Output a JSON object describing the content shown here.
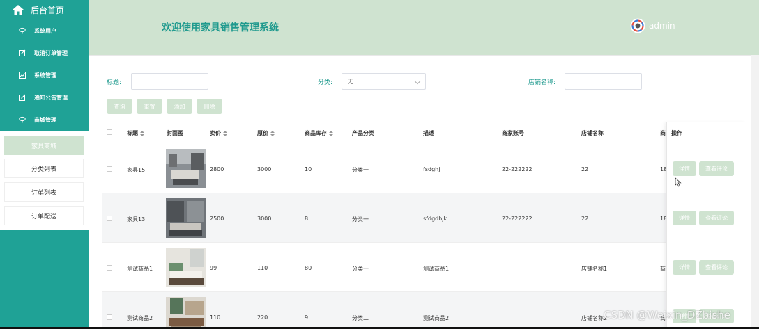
{
  "sidebar": {
    "home_label": "后台首页",
    "items": [
      {
        "label": "系统用户",
        "icon": "shield-icon"
      },
      {
        "label": "取消订单管理",
        "icon": "edit-icon"
      },
      {
        "label": "系统管理",
        "icon": "chart-icon"
      },
      {
        "label": "通知公告管理",
        "icon": "edit-icon"
      },
      {
        "label": "商城管理",
        "icon": "shield-icon"
      }
    ],
    "sub_items": [
      {
        "label": "家具商城",
        "active": true
      },
      {
        "label": "分类列表",
        "active": false
      },
      {
        "label": "订单列表",
        "active": false
      },
      {
        "label": "订单配送",
        "active": false
      }
    ]
  },
  "header": {
    "title": "欢迎使用家具销售管理系统",
    "username": "admin"
  },
  "search": {
    "title_label": "标题:",
    "title_value": "",
    "category_label": "分类:",
    "category_value": "无",
    "shop_label": "店铺名称:",
    "shop_value": ""
  },
  "actions": {
    "query": "查询",
    "reset": "重置",
    "add": "添加",
    "delete": "删除"
  },
  "table": {
    "columns": [
      "标题",
      "封面图",
      "卖价",
      "原价",
      "商品库存",
      "产品分类",
      "描述",
      "商家账号",
      "店铺名称",
      "商",
      "操作"
    ],
    "rows": [
      {
        "title": "家具15",
        "price": "2800",
        "original": "3000",
        "stock": "10",
        "category": "分类一",
        "desc": "fsdghj",
        "merchant": "22-222222",
        "shop": "22",
        "extra": "18"
      },
      {
        "title": "家具13",
        "price": "2500",
        "original": "3000",
        "stock": "8",
        "category": "分类一",
        "desc": "sfdgdhjk",
        "merchant": "22-222222",
        "shop": "22",
        "extra": "18"
      },
      {
        "title": "测试商品1",
        "price": "99",
        "original": "110",
        "stock": "80",
        "category": "分类一",
        "desc": "测试商品1",
        "merchant": "",
        "shop": "店铺名称1",
        "extra": "商"
      },
      {
        "title": "测试商品2",
        "price": "110",
        "original": "220",
        "stock": "9",
        "category": "分类二",
        "desc": "测试商品2",
        "merchant": "",
        "shop": "店铺名称2",
        "extra": "商"
      }
    ],
    "detail_label": "详情",
    "review_label": "查看评论"
  },
  "watermark": "CSDN @Weixin_DZbishe",
  "colors": {
    "sidebar": "#1fa296",
    "header": "#cfe3d0",
    "accent_text": "#1f9a8e",
    "button": "#cfe3d0"
  }
}
